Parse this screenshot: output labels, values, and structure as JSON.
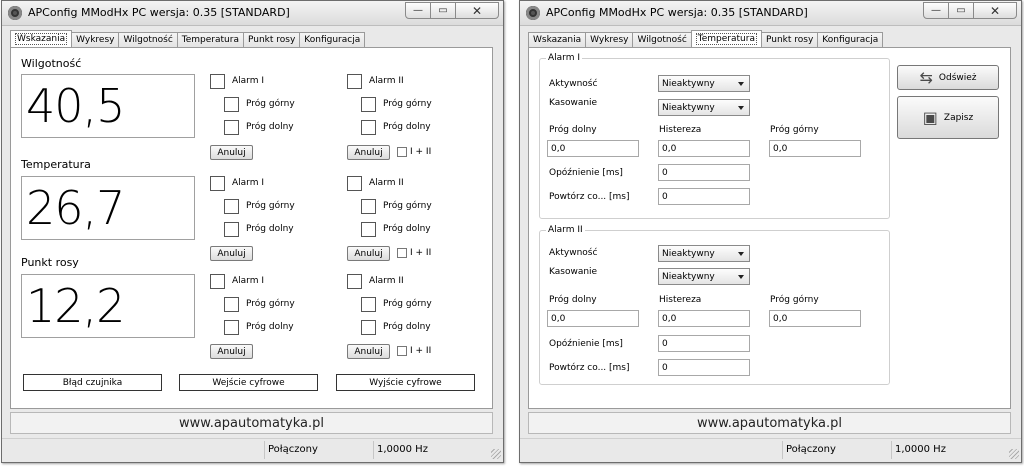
{
  "app": {
    "title": "APConfig MModHx PC  wersja: 0.35 [STANDARD]",
    "window_buttons": {
      "minimize": "—",
      "maximize": "▭",
      "close": "✕"
    }
  },
  "tabs": [
    "Wskazania",
    "Wykresy",
    "Wilgotność",
    "Temperatura",
    "Punkt rosy",
    "Konfiguracja"
  ],
  "left": {
    "active_tab": "Wskazania",
    "sections": [
      {
        "label": "Wilgotność",
        "value": "40,5"
      },
      {
        "label": "Temperatura",
        "value": "26,7"
      },
      {
        "label": "Punkt rosy",
        "value": "12,2"
      }
    ],
    "alarm1_label": "Alarm I",
    "alarm2_label": "Alarm II",
    "upper_label": "Próg górny",
    "lower_label": "Próg dolny",
    "cancel_label": "Anuluj",
    "both_label": "I + II",
    "bottom_buttons": [
      "Błąd czujnika",
      "Wejście cyfrowe",
      "Wyjście cyfrowe"
    ]
  },
  "right": {
    "active_tab": "Temperatura",
    "groups": [
      {
        "title": "Alarm I",
        "active_label": "Aktywność",
        "active_value": "Nieaktywny",
        "reset_label": "Kasowanie",
        "reset_value": "Nieaktywny",
        "lower_label": "Próg dolny",
        "lower_value": "0,0",
        "hyst_label": "Histereza",
        "hyst_value": "0,0",
        "upper_label": "Próg górny",
        "upper_value": "0,0",
        "delay_label": "Opóźnienie [ms]",
        "delay_value": "0",
        "repeat_label": "Powtórz co... [ms]",
        "repeat_value": "0"
      },
      {
        "title": "Alarm II",
        "active_label": "Aktywność",
        "active_value": "Nieaktywny",
        "reset_label": "Kasowanie",
        "reset_value": "Nieaktywny",
        "lower_label": "Próg dolny",
        "lower_value": "0,0",
        "hyst_label": "Histereza",
        "hyst_value": "0,0",
        "upper_label": "Próg górny",
        "upper_value": "0,0",
        "delay_label": "Opóźnienie [ms]",
        "delay_value": "0",
        "repeat_label": "Powtórz co... [ms]",
        "repeat_value": "0"
      }
    ],
    "refresh_label": "Odśwież",
    "save_label": "Zapisz"
  },
  "footer": {
    "url": "www.apautomatyka.pl"
  },
  "status": {
    "connection": "Połączony",
    "frequency": "1,0000 Hz"
  }
}
